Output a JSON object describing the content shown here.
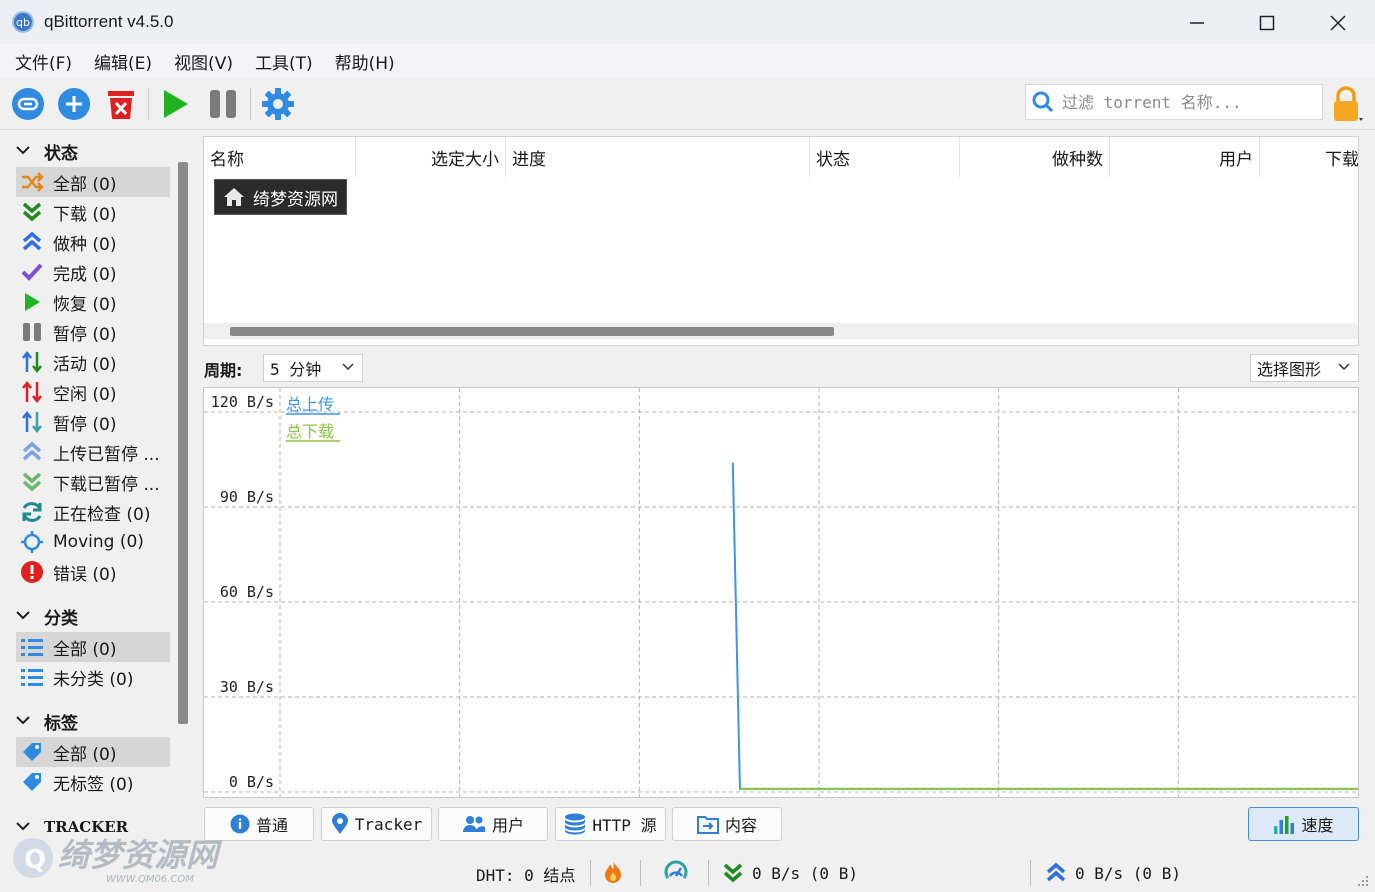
{
  "window": {
    "icon_text": "qb",
    "title": "qBittorrent v4.5.0",
    "minimize": "—",
    "maximize": "☐",
    "close": "✕"
  },
  "menu": [
    "文件(F)",
    "编辑(E)",
    "视图(V)",
    "工具(T)",
    "帮助(H)"
  ],
  "toolbar": {
    "search_placeholder": "过滤 torrent 名称..."
  },
  "sidebar": {
    "status": {
      "title": "状态",
      "items": [
        {
          "label": "全部 (0)",
          "icon": "shuffle-icon",
          "selected": true
        },
        {
          "label": "下载 (0)",
          "icon": "download-icon"
        },
        {
          "label": "做种 (0)",
          "icon": "upload-icon"
        },
        {
          "label": "完成 (0)",
          "icon": "check-icon"
        },
        {
          "label": "恢复 (0)",
          "icon": "play-icon"
        },
        {
          "label": "暂停 (0)",
          "icon": "pause-icon"
        },
        {
          "label": "活动 (0)",
          "icon": "active-arrows-icon"
        },
        {
          "label": "空闲 (0)",
          "icon": "inactive-arrows-icon"
        },
        {
          "label": "暂停 (0)",
          "icon": "stalled-arrows-icon"
        },
        {
          "label": "上传已暂停 ...",
          "icon": "upload-paused-icon"
        },
        {
          "label": "下载已暂停 ...",
          "icon": "download-paused-icon"
        },
        {
          "label": "正在检查 (0)",
          "icon": "refresh-icon"
        },
        {
          "label": "Moving (0)",
          "icon": "moving-icon"
        },
        {
          "label": "错误 (0)",
          "icon": "error-icon"
        }
      ]
    },
    "categories": {
      "title": "分类",
      "items": [
        {
          "label": "全部 (0)",
          "icon": "list-icon",
          "selected": true
        },
        {
          "label": "未分类 (0)",
          "icon": "list-icon"
        }
      ]
    },
    "tags": {
      "title": "标签",
      "items": [
        {
          "label": "全部 (0)",
          "icon": "tag-icon",
          "selected": true
        },
        {
          "label": "无标签 (0)",
          "icon": "tag-icon"
        }
      ]
    },
    "trackers": {
      "title": "TRACKER"
    }
  },
  "list": {
    "columns": [
      "名称",
      "选定大小",
      "进度",
      "状态",
      "做种数",
      "用户",
      "下载"
    ],
    "tooltip": "绮梦资源网"
  },
  "graph": {
    "period_label": "周期:",
    "period_value": "5 分钟",
    "graph_select": "选择图形",
    "legend_upload": "总上传",
    "legend_download": "总下载"
  },
  "chart_data": {
    "type": "line",
    "ylabel_ticks": [
      "120 B/s",
      "90 B/s",
      "60 B/s",
      "30 B/s",
      "0 B/s"
    ],
    "ylim": [
      0,
      120
    ],
    "x_range_seconds": [
      0,
      300
    ],
    "grid": true,
    "legend_position": "top-left",
    "series": [
      {
        "name": "总上传",
        "color": "#3d95e6",
        "x": [
          126,
          128,
          300
        ],
        "values": [
          104,
          1,
          1
        ]
      },
      {
        "name": "总下载",
        "color": "#8cc63f",
        "x": [
          128,
          300
        ],
        "values": [
          1,
          1
        ]
      }
    ]
  },
  "tabs": [
    {
      "label": "普通",
      "icon": "info-icon"
    },
    {
      "label": "Tracker",
      "icon": "location-pin-icon"
    },
    {
      "label": "用户",
      "icon": "users-icon"
    },
    {
      "label": "HTTP 源",
      "icon": "database-icon"
    },
    {
      "label": "内容",
      "icon": "content-icon"
    },
    {
      "label": "速度",
      "icon": "bar-chart-icon",
      "active": true
    }
  ],
  "status": {
    "dht": "DHT: 0 结点",
    "download": "0 B/s (0 B)",
    "upload": "0 B/s (0 B)"
  },
  "site_watermark": {
    "text": "绮梦资源网",
    "url": "WWW.QM06.COM"
  },
  "colors": {
    "accent_blue": "#3d95e6",
    "green": "#21a121",
    "red": "#e02020",
    "upload_line": "#3d95e6",
    "download_line": "#8cc63f"
  }
}
